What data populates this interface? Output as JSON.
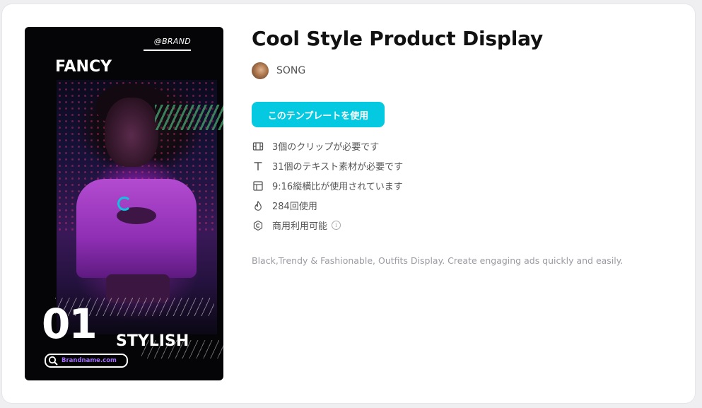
{
  "preview": {
    "brand_handle": "@BRAND",
    "heading_text": "FANCY",
    "number_text": "01",
    "subheading_text": "STYLISH",
    "search_text": "Brandname.com",
    "loading": true
  },
  "template": {
    "title": "Cool Style Product Display",
    "author": "SONG",
    "use_button_label": "このテンプレートを使用",
    "description": "Black,Trendy & Fashionable, Outfits Display. Create engaging ads quickly and easily."
  },
  "features": [
    {
      "icon": "film-icon",
      "label": "3個のクリップが必要です"
    },
    {
      "icon": "text-icon",
      "label": "31個のテキスト素材が必要です"
    },
    {
      "icon": "layout-icon",
      "label": "9:16縦横比が使用されています"
    },
    {
      "icon": "flame-icon",
      "label": "284回使用"
    },
    {
      "icon": "shield-copyright-icon",
      "label": "商用利用可能"
    }
  ],
  "colors": {
    "accent": "#05c8e1",
    "text_primary": "#111111",
    "text_secondary": "#555555",
    "text_muted": "#9a9aa2"
  }
}
